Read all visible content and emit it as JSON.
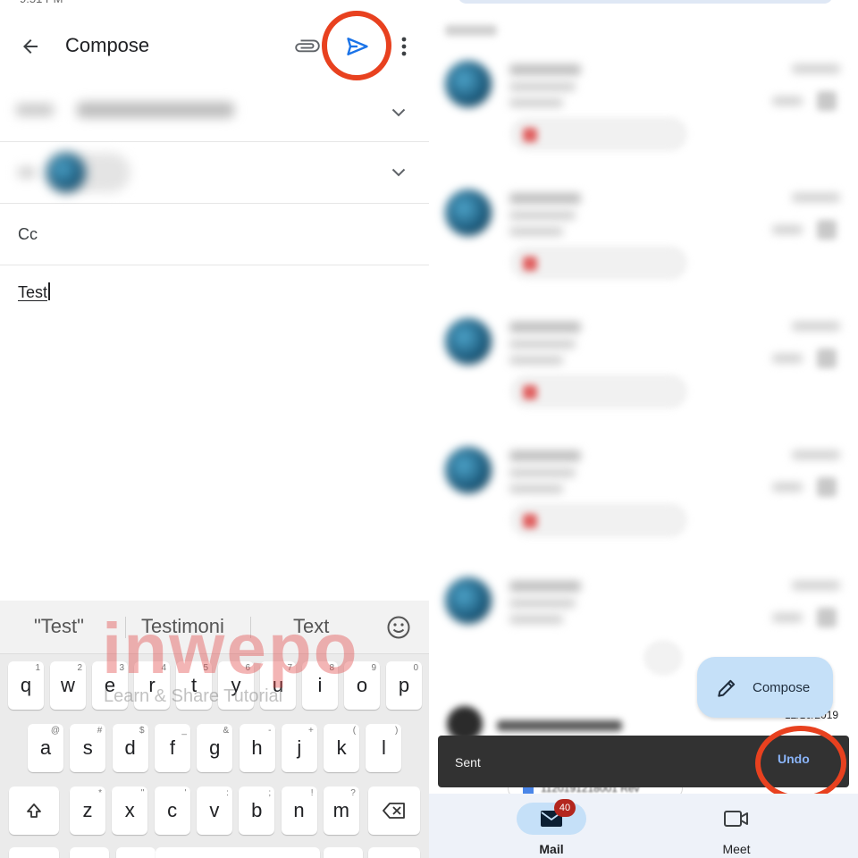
{
  "compose": {
    "title": "Compose",
    "cc_label": "Cc",
    "subject": "Test",
    "accent_color": "#1a73e8",
    "highlight_color": "#e8411f"
  },
  "keyboard": {
    "suggestions": [
      "\"Test\"",
      "Testimoni",
      "Text"
    ],
    "row1": [
      {
        "k": "q",
        "h": "1"
      },
      {
        "k": "w",
        "h": "2"
      },
      {
        "k": "e",
        "h": "3"
      },
      {
        "k": "r",
        "h": "4"
      },
      {
        "k": "t",
        "h": "5"
      },
      {
        "k": "y",
        "h": "6"
      },
      {
        "k": "u",
        "h": "7"
      },
      {
        "k": "i",
        "h": "8"
      },
      {
        "k": "o",
        "h": "9"
      },
      {
        "k": "p",
        "h": "0"
      }
    ],
    "row2": [
      {
        "k": "a",
        "h": "@"
      },
      {
        "k": "s",
        "h": "#"
      },
      {
        "k": "d",
        "h": "$"
      },
      {
        "k": "f",
        "h": "_"
      },
      {
        "k": "g",
        "h": "&"
      },
      {
        "k": "h",
        "h": "-"
      },
      {
        "k": "j",
        "h": "+"
      },
      {
        "k": "k",
        "h": "("
      },
      {
        "k": "l",
        "h": ")"
      }
    ],
    "row3": [
      {
        "k": "z",
        "h": "*"
      },
      {
        "k": "x",
        "h": "\""
      },
      {
        "k": "c",
        "h": "'"
      },
      {
        "k": "v",
        "h": ":"
      },
      {
        "k": "b",
        "h": ";"
      },
      {
        "k": "n",
        "h": "!"
      },
      {
        "k": "m",
        "h": "?"
      }
    ],
    "shift_icon": "shift-arrow-icon",
    "backspace_icon": "backspace-icon"
  },
  "watermark": {
    "main": "inwepo",
    "sub": "Learn & Share Tutorial"
  },
  "inbox": {
    "fab_label": "Compose",
    "peek_date": "12/10/2019",
    "attachment_peek": "1120191218001 Rev",
    "snackbar_text": "Sent",
    "snackbar_action": "Undo",
    "nav": {
      "mail_label": "Mail",
      "mail_badge": "40",
      "meet_label": "Meet"
    }
  }
}
